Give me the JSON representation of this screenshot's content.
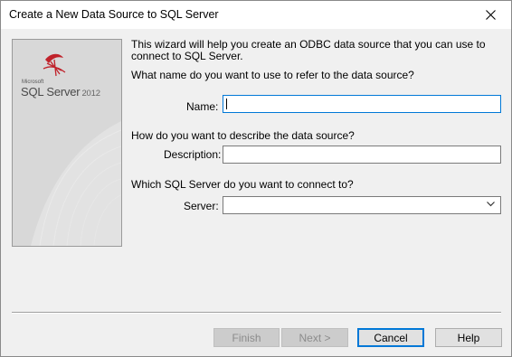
{
  "window": {
    "title": "Create a New Data Source to SQL Server"
  },
  "banner": {
    "logo_small": "Microsoft",
    "logo_product": "SQL Server",
    "logo_version": "2012"
  },
  "intro_text": "This wizard will help you create an ODBC data source that you can use to connect to SQL Server.",
  "name_question": "What name do you want to use to refer to the data source?",
  "name_label": "Name:",
  "name_value": "",
  "description_question": "How do you want to describe the data source?",
  "description_label": "Description:",
  "description_value": "",
  "server_question": "Which SQL Server do you want to connect to?",
  "server_label": "Server:",
  "server_value": "",
  "buttons": {
    "finish": "Finish",
    "next": "Next >",
    "cancel": "Cancel",
    "help": "Help"
  },
  "icons": {
    "close": "close-icon",
    "logo": "sql-server-logo-icon",
    "dropdown": "chevron-down-icon"
  }
}
